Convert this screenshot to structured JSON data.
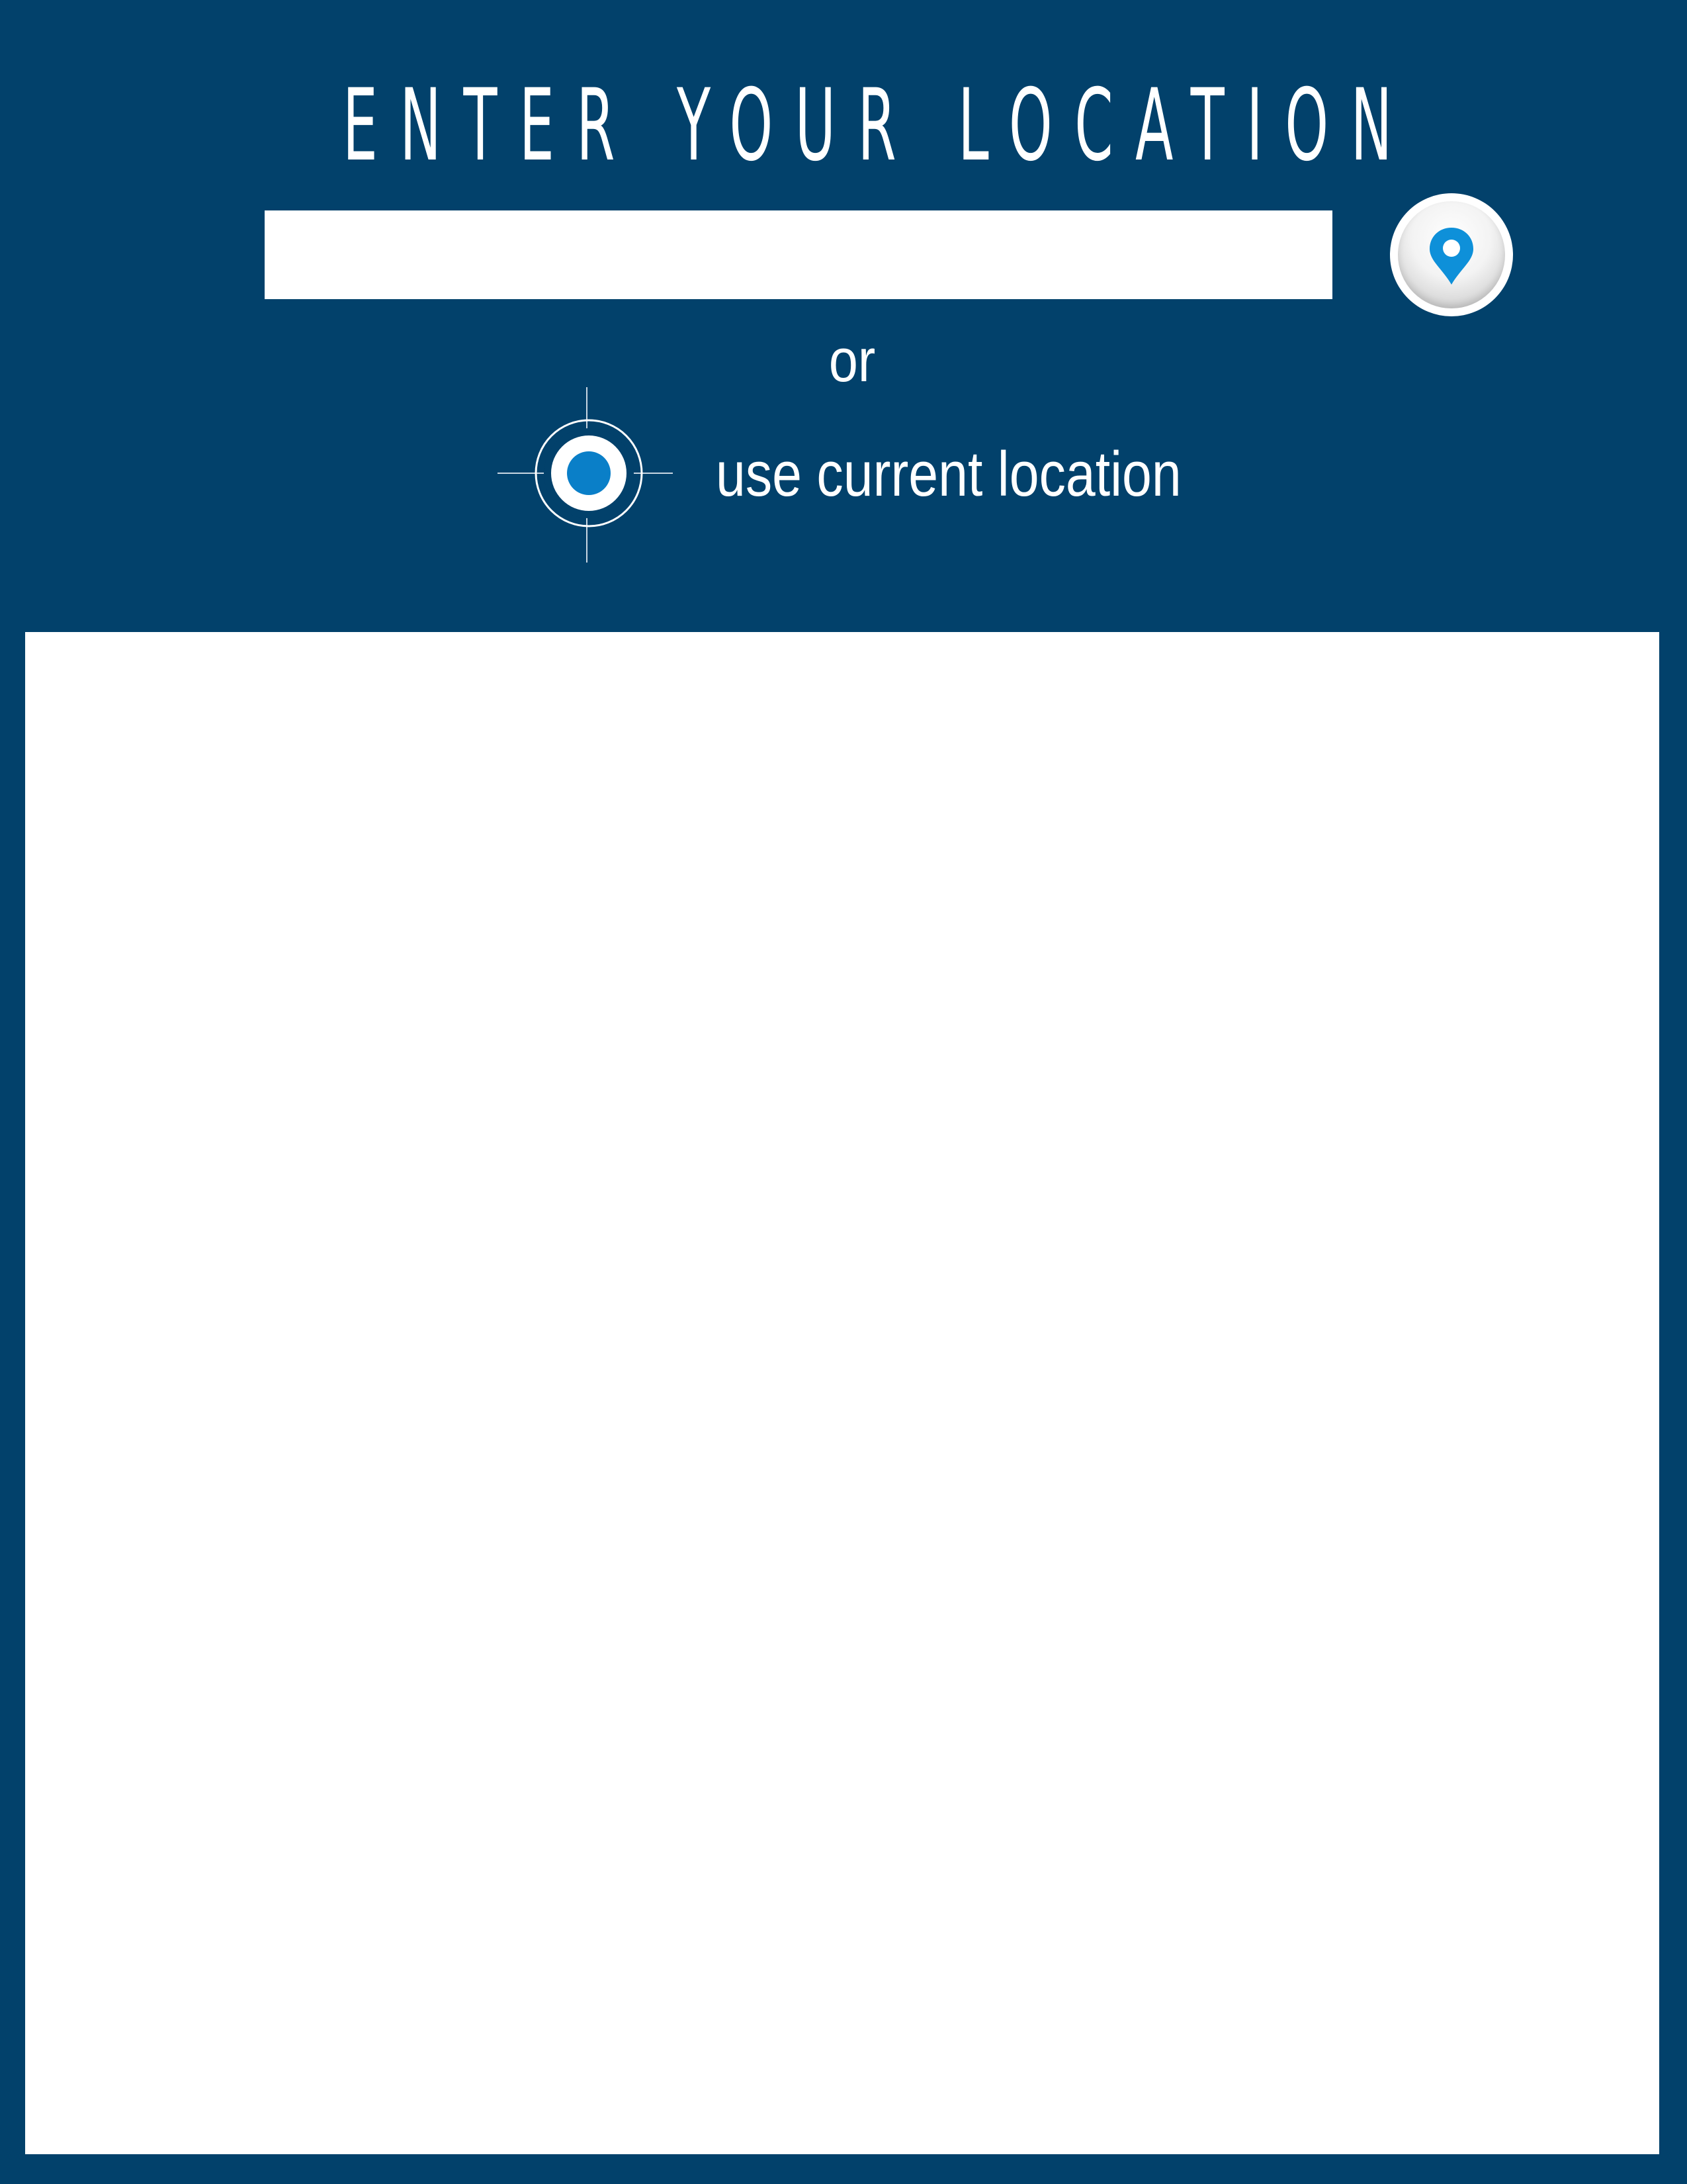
{
  "header": {
    "title": "ENTER YOUR LOCATION"
  },
  "search": {
    "value": "",
    "placeholder": ""
  },
  "locate_button": {
    "icon": "map-pin-icon"
  },
  "separator": {
    "text": "or"
  },
  "current_location": {
    "label": "use current location",
    "icon": "crosshair-target-icon"
  },
  "colors": {
    "background": "#02416b",
    "accent": "#0e90d9",
    "target_dot": "#0a7fc8",
    "panel": "#ffffff"
  }
}
